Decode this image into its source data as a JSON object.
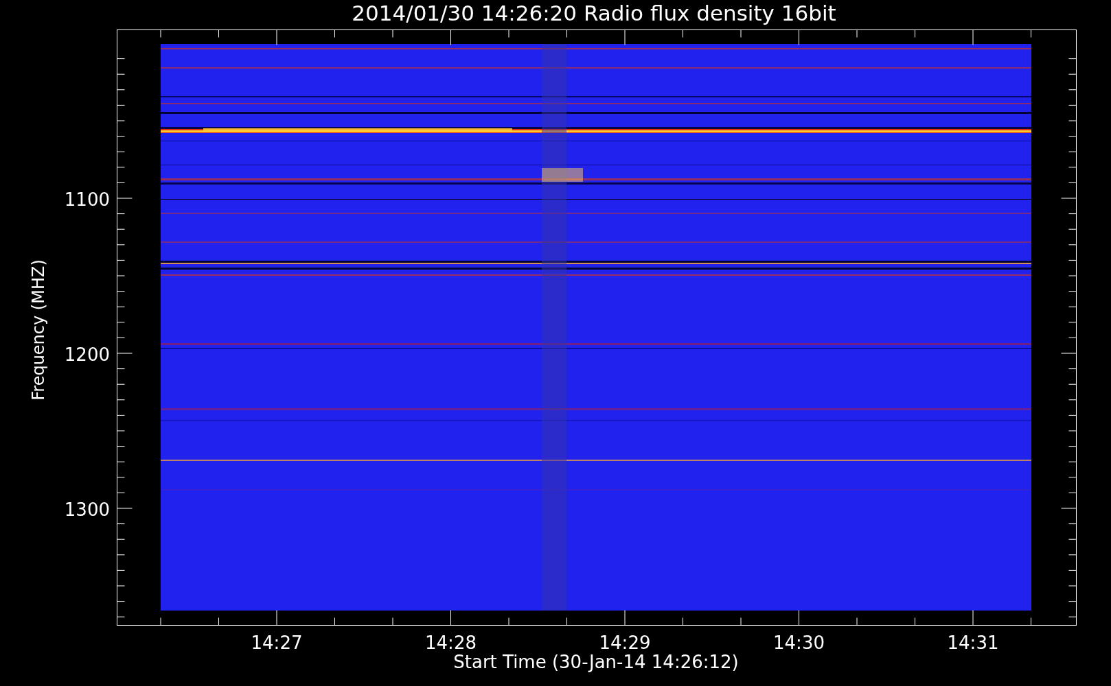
{
  "plot": {
    "title": "2014/01/30 14:26:20 Radio flux density 16bit",
    "y_axis": {
      "label": "Frequency (MHZ)",
      "ticks": [
        "1100",
        "1200",
        "1300"
      ]
    },
    "x_axis": {
      "label": "Start Time (30-Jan-14 14:26:12)",
      "ticks": [
        "14:27",
        "14:28",
        "14:29",
        "14:30",
        "14:31"
      ]
    }
  }
}
